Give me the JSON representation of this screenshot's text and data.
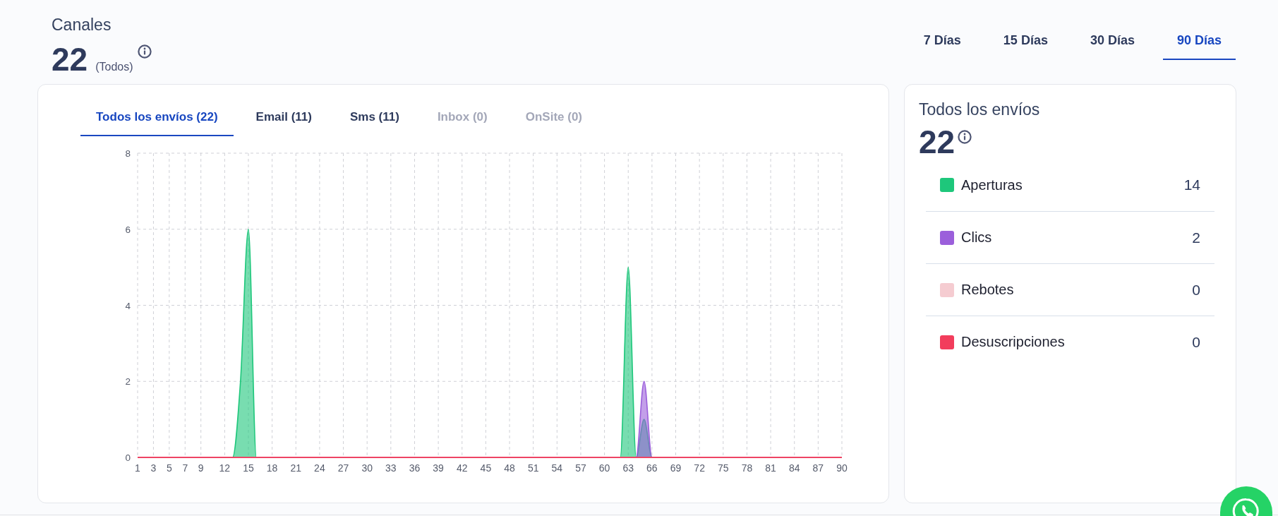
{
  "header": {
    "title": "Canales",
    "total": "22",
    "scope": "(Todos)"
  },
  "period_tabs": [
    {
      "label": "7 Días",
      "selected": false
    },
    {
      "label": "15 Días",
      "selected": false
    },
    {
      "label": "30 Días",
      "selected": false
    },
    {
      "label": "90 Días",
      "selected": true
    }
  ],
  "channel_card": {
    "tabs": [
      {
        "label": "Todos los envíos (22)",
        "selected": true,
        "disabled": false
      },
      {
        "label": "Email (11)",
        "selected": false,
        "disabled": false
      },
      {
        "label": "Sms (11)",
        "selected": false,
        "disabled": false
      },
      {
        "label": "Inbox (0)",
        "selected": false,
        "disabled": true
      },
      {
        "label": "OnSite (0)",
        "selected": false,
        "disabled": true
      }
    ],
    "chart_data": {
      "type": "area",
      "grid": true,
      "x": [
        1,
        2,
        3,
        4,
        5,
        6,
        7,
        8,
        9,
        10,
        11,
        12,
        13,
        14,
        15,
        16,
        17,
        18,
        19,
        20,
        21,
        22,
        23,
        24,
        25,
        26,
        27,
        28,
        29,
        30,
        31,
        32,
        33,
        34,
        35,
        36,
        37,
        38,
        39,
        40,
        41,
        42,
        43,
        44,
        45,
        46,
        47,
        48,
        49,
        50,
        51,
        52,
        53,
        54,
        55,
        56,
        57,
        58,
        59,
        60,
        61,
        62,
        63,
        64,
        65,
        66,
        67,
        68,
        69,
        70,
        71,
        72,
        73,
        74,
        75,
        76,
        77,
        78,
        79,
        80,
        81,
        82,
        83,
        84,
        85,
        86,
        87,
        88,
        89,
        90
      ],
      "xlim": [
        1,
        90
      ],
      "ylim": [
        0,
        8
      ],
      "xticks": [
        1,
        3,
        5,
        7,
        9,
        12,
        15,
        18,
        21,
        24,
        27,
        30,
        33,
        36,
        39,
        42,
        45,
        48,
        51,
        54,
        57,
        60,
        63,
        66,
        69,
        72,
        75,
        78,
        81,
        84,
        87,
        90
      ],
      "yticks": [
        0,
        2,
        4,
        6,
        8
      ],
      "series": [
        {
          "color": "#1ec77b",
          "values": [
            0,
            0,
            0,
            0,
            0,
            0,
            0,
            0,
            0,
            0,
            0,
            0,
            0,
            2,
            6,
            0,
            0,
            0,
            0,
            0,
            0,
            0,
            0,
            0,
            0,
            0,
            0,
            0,
            0,
            0,
            0,
            0,
            0,
            0,
            0,
            0,
            0,
            0,
            0,
            0,
            0,
            0,
            0,
            0,
            0,
            0,
            0,
            0,
            0,
            0,
            0,
            0,
            0,
            0,
            0,
            0,
            0,
            0,
            0,
            0,
            0,
            0,
            5,
            0,
            1,
            0,
            0,
            0,
            0,
            0,
            0,
            0,
            0,
            0,
            0,
            0,
            0,
            0,
            0,
            0,
            0,
            0,
            0,
            0,
            0,
            0,
            0,
            0,
            0,
            0
          ]
        },
        {
          "color": "#9b5fdb",
          "values": [
            0,
            0,
            0,
            0,
            0,
            0,
            0,
            0,
            0,
            0,
            0,
            0,
            0,
            0,
            0,
            0,
            0,
            0,
            0,
            0,
            0,
            0,
            0,
            0,
            0,
            0,
            0,
            0,
            0,
            0,
            0,
            0,
            0,
            0,
            0,
            0,
            0,
            0,
            0,
            0,
            0,
            0,
            0,
            0,
            0,
            0,
            0,
            0,
            0,
            0,
            0,
            0,
            0,
            0,
            0,
            0,
            0,
            0,
            0,
            0,
            0,
            0,
            0,
            0,
            2,
            0,
            0,
            0,
            0,
            0,
            0,
            0,
            0,
            0,
            0,
            0,
            0,
            0,
            0,
            0,
            0,
            0,
            0,
            0,
            0,
            0,
            0,
            0,
            0,
            0
          ]
        }
      ]
    }
  },
  "summary_card": {
    "title": "Todos los envíos",
    "total": "22",
    "items": [
      {
        "label": "Aperturas",
        "value": "14",
        "color": "#1ec77b"
      },
      {
        "label": "Clics",
        "value": "2",
        "color": "#9b5fdb"
      },
      {
        "label": "Rebotes",
        "value": "0",
        "color": "#f5ccd1"
      },
      {
        "label": "Desuscripciones",
        "value": "0",
        "color": "#f23d5c"
      }
    ]
  }
}
